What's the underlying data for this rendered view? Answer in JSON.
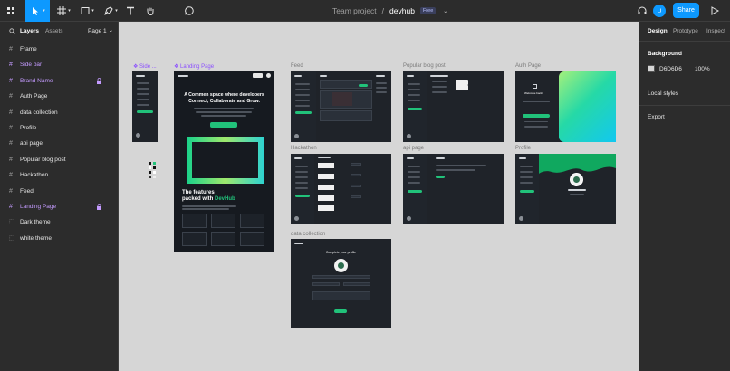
{
  "toolbar": {
    "project": "Team project",
    "separator": "/",
    "file": "devhub",
    "plan_badge": "Free",
    "share_label": "Share",
    "avatar_initial": "U"
  },
  "left_panel": {
    "tabs": [
      "Layers",
      "Assets"
    ],
    "page": "Page 1",
    "layers": [
      {
        "label": "Frame",
        "icon": "frame-icon",
        "locked": false,
        "purple": false
      },
      {
        "label": "Side bar",
        "icon": "frame-icon",
        "locked": false,
        "purple": true
      },
      {
        "label": "Brand Name",
        "icon": "frame-icon",
        "locked": true,
        "purple": true
      },
      {
        "label": "Auth Page",
        "icon": "frame-icon",
        "locked": false,
        "purple": false
      },
      {
        "label": "data collection",
        "icon": "frame-icon",
        "locked": false,
        "purple": false
      },
      {
        "label": "Profile",
        "icon": "frame-icon",
        "locked": false,
        "purple": false
      },
      {
        "label": "api page",
        "icon": "frame-icon",
        "locked": false,
        "purple": false
      },
      {
        "label": "Popular blog post",
        "icon": "frame-icon",
        "locked": false,
        "purple": false
      },
      {
        "label": "Hackathon",
        "icon": "frame-icon",
        "locked": false,
        "purple": false
      },
      {
        "label": "Feed",
        "icon": "frame-icon",
        "locked": false,
        "purple": false
      },
      {
        "label": "Landing Page",
        "icon": "frame-icon",
        "locked": true,
        "purple": true
      },
      {
        "label": "Dark theme",
        "icon": "section-icon",
        "locked": false,
        "purple": false
      },
      {
        "label": "white theme",
        "icon": "section-icon",
        "locked": false,
        "purple": false
      }
    ]
  },
  "right_panel": {
    "tabs": [
      "Design",
      "Prototype",
      "Inspect"
    ],
    "background_title": "Background",
    "bg_color": "#D6D6D6",
    "bg_hex": "D6D6D6",
    "bg_opacity": "100%",
    "local_styles": "Local styles",
    "export": "Export"
  },
  "frames": {
    "side": "Side ...",
    "landing": "Landing Page",
    "feed": "Feed",
    "blog": "Popular blog post",
    "auth": "Auth Page",
    "hackathon": "Hackathon",
    "api": "api page",
    "profile": "Profile",
    "data": "data collection"
  },
  "landing_content": {
    "headline_1": "A Commen space where developers",
    "headline_2": "Connect, Collaborate and Grow.",
    "features_1": "The features",
    "features_2": "packed with",
    "brand": "DevHub"
  },
  "auth_content": {
    "welcome": "Welcome back!"
  },
  "data_content": {
    "title": "Complete your profile"
  },
  "colors": {
    "accent": "#0d99ff",
    "brand_green": "#21c27a",
    "purple": "#8a4dff",
    "canvas": "#d6d6d6",
    "frame_bg": "#1f2329"
  }
}
